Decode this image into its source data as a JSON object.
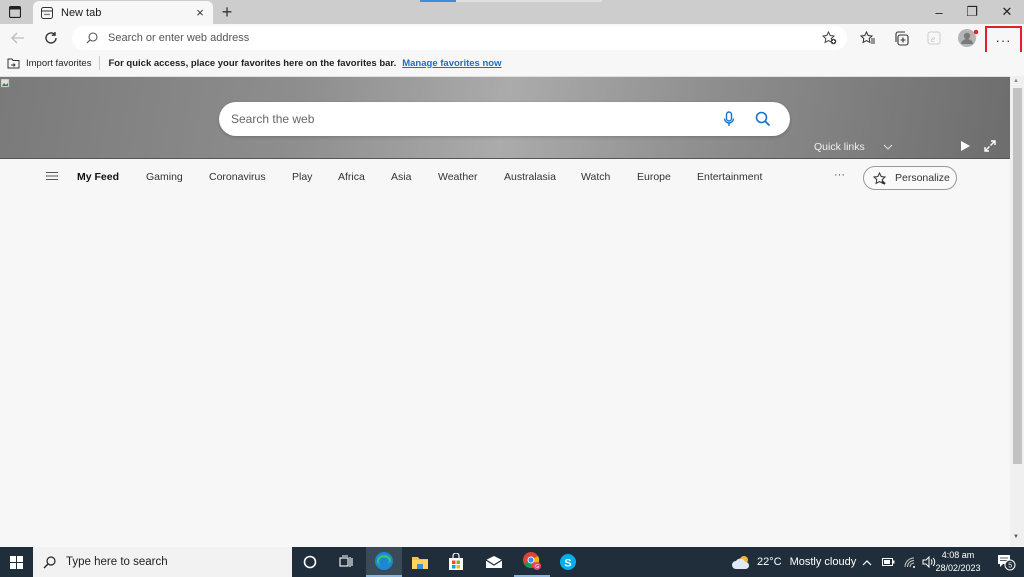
{
  "browser": {
    "tab": {
      "title": "New tab",
      "close_label": "×"
    },
    "new_tab_label": "+",
    "window_controls": {
      "minimize": "–",
      "restore": "❐",
      "close": "✕"
    },
    "address_bar": {
      "placeholder": "Search or enter web address",
      "value": ""
    },
    "menu_label": "···",
    "highlight_color": "#e0202a",
    "favorites_bar": {
      "import_label": "Import favorites",
      "hint_text": "For quick access, place your favorites here on the favorites bar.",
      "manage_link": "Manage favorites now"
    }
  },
  "new_tab_page": {
    "search": {
      "placeholder": "Search the web",
      "value": ""
    },
    "quick_links_label": "Quick links",
    "feed_nav": {
      "items": [
        {
          "label": "My Feed",
          "active": true
        },
        {
          "label": "Gaming"
        },
        {
          "label": "Coronavirus"
        },
        {
          "label": "Play"
        },
        {
          "label": "Africa"
        },
        {
          "label": "Asia"
        },
        {
          "label": "Weather"
        },
        {
          "label": "Australasia"
        },
        {
          "label": "Watch"
        },
        {
          "label": "Europe"
        },
        {
          "label": "Entertainment"
        }
      ],
      "more_label": "···",
      "personalize_label": "Personalize"
    }
  },
  "taskbar": {
    "search_placeholder": "Type here to search",
    "apps": [
      "cortana",
      "task-view",
      "edge",
      "file-explorer",
      "microsoft-store",
      "mail",
      "chrome",
      "skype"
    ],
    "weather": {
      "temp": "22°C",
      "condition": "Mostly cloudy"
    },
    "clock": {
      "time": "4:08 am",
      "date": "28/02/2023"
    },
    "notification_count": "5"
  }
}
